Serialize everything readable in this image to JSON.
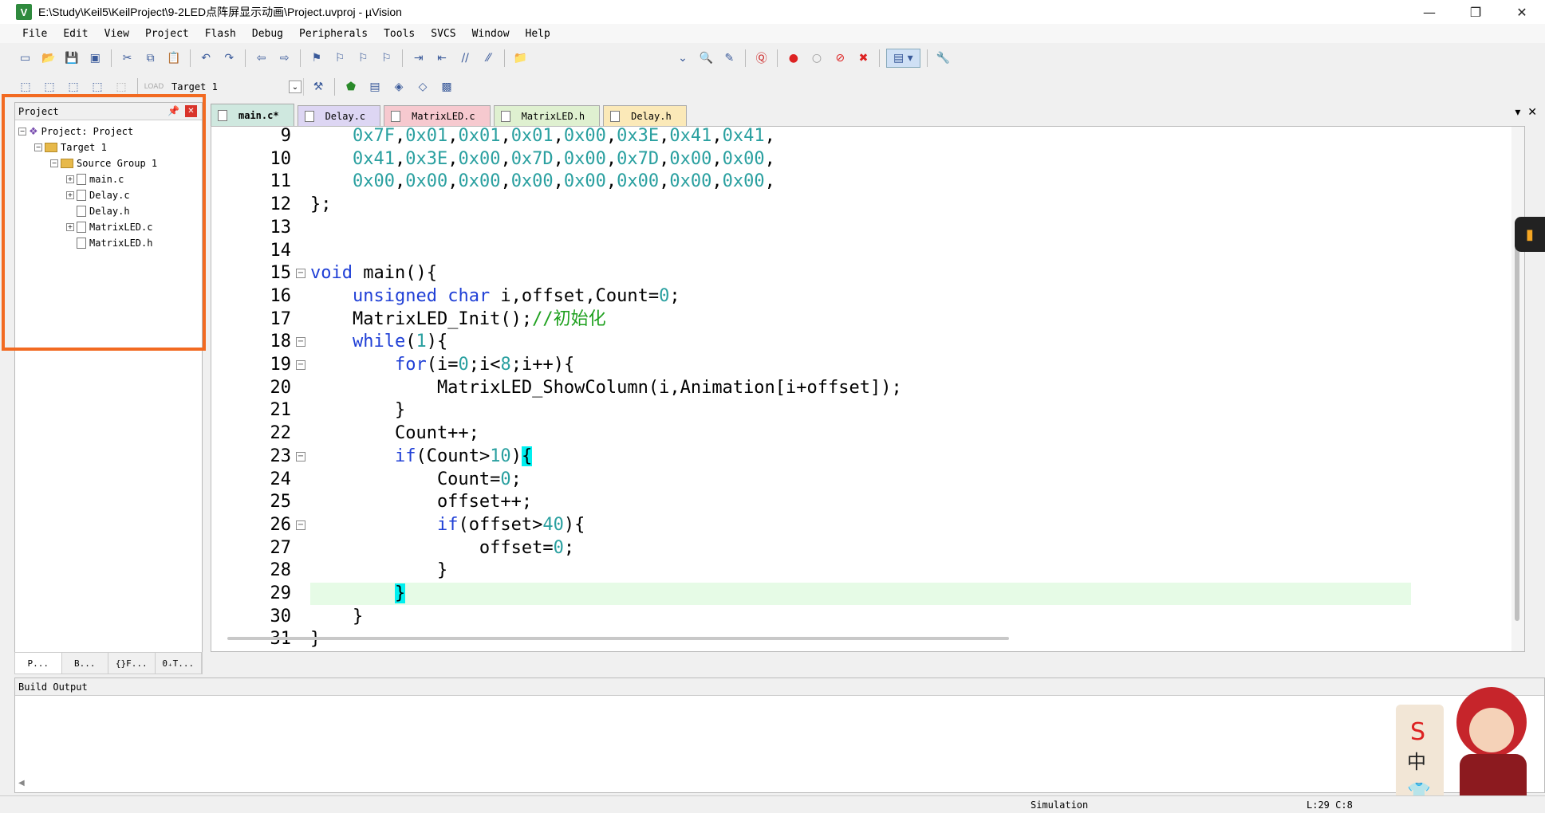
{
  "window": {
    "title": "E:\\Study\\Keil5\\KeilProject\\9-2LED点阵屏显示动画\\Project.uvproj - µVision",
    "app_icon": "V",
    "controls": [
      "—",
      "❐",
      "✕"
    ]
  },
  "menu": [
    "File",
    "Edit",
    "View",
    "Project",
    "Flash",
    "Debug",
    "Peripherals",
    "Tools",
    "SVCS",
    "Window",
    "Help"
  ],
  "toolbar2": {
    "target": "Target 1"
  },
  "project_panel": {
    "title": "Project",
    "tree": [
      {
        "label": "Project: Project",
        "depth": 0,
        "kind": "project",
        "expander": "⊟"
      },
      {
        "label": "Target 1",
        "depth": 1,
        "kind": "folder",
        "expander": "⊟"
      },
      {
        "label": "Source Group 1",
        "depth": 2,
        "kind": "folder",
        "expander": "⊟"
      },
      {
        "label": "main.c",
        "depth": 3,
        "kind": "file",
        "expander": "⊞"
      },
      {
        "label": "Delay.c",
        "depth": 3,
        "kind": "file",
        "expander": "⊞"
      },
      {
        "label": "Delay.h",
        "depth": 3,
        "kind": "file",
        "expander": ""
      },
      {
        "label": "MatrixLED.c",
        "depth": 3,
        "kind": "file",
        "expander": "⊞"
      },
      {
        "label": "MatrixLED.h",
        "depth": 3,
        "kind": "file",
        "expander": ""
      }
    ],
    "tabs": [
      "P...",
      "B...",
      "{}F...",
      "0₊T..."
    ]
  },
  "editor": {
    "tabs": [
      {
        "label": "main.c*",
        "color": "#cfe8df",
        "active": true
      },
      {
        "label": "Delay.c",
        "color": "#ddd6f3",
        "active": false
      },
      {
        "label": "MatrixLED.c",
        "color": "#f6c9cf",
        "active": false
      },
      {
        "label": "MatrixLED.h",
        "color": "#dff0d0",
        "active": false
      },
      {
        "label": "Delay.h",
        "color": "#fbe9b8",
        "active": false
      }
    ],
    "lines": [
      {
        "n": "9",
        "fold": "",
        "segs": [
          [
            "    ",
            ""
          ],
          [
            "0x7F",
            "num"
          ],
          [
            ",",
            ""
          ],
          [
            "0x01",
            "num"
          ],
          [
            ",",
            ""
          ],
          [
            "0x01",
            "num"
          ],
          [
            ",",
            ""
          ],
          [
            "0x01",
            "num"
          ],
          [
            ",",
            ""
          ],
          [
            "0x00",
            "num"
          ],
          [
            ",",
            ""
          ],
          [
            "0x3E",
            "num"
          ],
          [
            ",",
            ""
          ],
          [
            "0x41",
            "num"
          ],
          [
            ",",
            ""
          ],
          [
            "0x41",
            "num"
          ],
          [
            ",",
            ""
          ]
        ]
      },
      {
        "n": "10",
        "fold": "",
        "segs": [
          [
            "    ",
            ""
          ],
          [
            "0x41",
            "num"
          ],
          [
            ",",
            ""
          ],
          [
            "0x3E",
            "num"
          ],
          [
            ",",
            ""
          ],
          [
            "0x00",
            "num"
          ],
          [
            ",",
            ""
          ],
          [
            "0x7D",
            "num"
          ],
          [
            ",",
            ""
          ],
          [
            "0x00",
            "num"
          ],
          [
            ",",
            ""
          ],
          [
            "0x7D",
            "num"
          ],
          [
            ",",
            ""
          ],
          [
            "0x00",
            "num"
          ],
          [
            ",",
            ""
          ],
          [
            "0x00",
            "num"
          ],
          [
            ",",
            ""
          ]
        ]
      },
      {
        "n": "11",
        "fold": "",
        "segs": [
          [
            "    ",
            ""
          ],
          [
            "0x00",
            "num"
          ],
          [
            ",",
            ""
          ],
          [
            "0x00",
            "num"
          ],
          [
            ",",
            ""
          ],
          [
            "0x00",
            "num"
          ],
          [
            ",",
            ""
          ],
          [
            "0x00",
            "num"
          ],
          [
            ",",
            ""
          ],
          [
            "0x00",
            "num"
          ],
          [
            ",",
            ""
          ],
          [
            "0x00",
            "num"
          ],
          [
            ",",
            ""
          ],
          [
            "0x00",
            "num"
          ],
          [
            ",",
            ""
          ],
          [
            "0x00",
            "num"
          ],
          [
            ",",
            ""
          ]
        ]
      },
      {
        "n": "12",
        "fold": "",
        "segs": [
          [
            "};",
            ""
          ]
        ]
      },
      {
        "n": "13",
        "fold": "",
        "segs": []
      },
      {
        "n": "14",
        "fold": "",
        "segs": []
      },
      {
        "n": "15",
        "fold": "⊟",
        "segs": [
          [
            "void",
            "kw"
          ],
          [
            " main(){",
            ""
          ]
        ]
      },
      {
        "n": "16",
        "fold": "",
        "segs": [
          [
            "    ",
            ""
          ],
          [
            "unsigned",
            "kw"
          ],
          [
            " ",
            ""
          ],
          [
            "char",
            "kw"
          ],
          [
            " i,offset,Count=",
            ""
          ],
          [
            "0",
            "num"
          ],
          [
            ";",
            ""
          ]
        ]
      },
      {
        "n": "17",
        "fold": "",
        "segs": [
          [
            "    MatrixLED_Init();",
            ""
          ],
          [
            "//初始化",
            "cm"
          ]
        ]
      },
      {
        "n": "18",
        "fold": "⊟",
        "segs": [
          [
            "    ",
            ""
          ],
          [
            "while",
            "kw"
          ],
          [
            "(",
            ""
          ],
          [
            "1",
            "num"
          ],
          [
            "){",
            ""
          ]
        ]
      },
      {
        "n": "19",
        "fold": "⊟",
        "segs": [
          [
            "        ",
            ""
          ],
          [
            "for",
            "kw"
          ],
          [
            "(i=",
            ""
          ],
          [
            "0",
            "num"
          ],
          [
            ";i<",
            ""
          ],
          [
            "8",
            "num"
          ],
          [
            ";i++){",
            ""
          ]
        ]
      },
      {
        "n": "20",
        "fold": "",
        "segs": [
          [
            "            MatrixLED_ShowColumn(i,Animation[i+offset]);",
            ""
          ]
        ]
      },
      {
        "n": "21",
        "fold": "",
        "segs": [
          [
            "        }",
            ""
          ]
        ]
      },
      {
        "n": "22",
        "fold": "",
        "segs": [
          [
            "        Count++;",
            ""
          ]
        ]
      },
      {
        "n": "23",
        "fold": "⊟",
        "segs": [
          [
            "        ",
            ""
          ],
          [
            "if",
            "kw"
          ],
          [
            "(Count>",
            ""
          ],
          [
            "10",
            "num"
          ],
          [
            ")",
            ""
          ],
          [
            "{",
            "caret"
          ]
        ]
      },
      {
        "n": "24",
        "fold": "",
        "segs": [
          [
            "            Count=",
            ""
          ],
          [
            "0",
            "num"
          ],
          [
            ";",
            ""
          ]
        ]
      },
      {
        "n": "25",
        "fold": "",
        "segs": [
          [
            "            offset++;",
            ""
          ]
        ]
      },
      {
        "n": "26",
        "fold": "⊟",
        "segs": [
          [
            "            ",
            ""
          ],
          [
            "if",
            "kw"
          ],
          [
            "(offset>",
            ""
          ],
          [
            "40",
            "num"
          ],
          [
            "){",
            ""
          ]
        ]
      },
      {
        "n": "27",
        "fold": "",
        "segs": [
          [
            "                offset=",
            ""
          ],
          [
            "0",
            "num"
          ],
          [
            ";",
            ""
          ]
        ]
      },
      {
        "n": "28",
        "fold": "",
        "segs": [
          [
            "            }",
            ""
          ]
        ]
      },
      {
        "n": "29",
        "fold": "",
        "current": true,
        "segs": [
          [
            "        ",
            ""
          ],
          [
            "}",
            "caret"
          ]
        ]
      },
      {
        "n": "30",
        "fold": "",
        "segs": [
          [
            "    }",
            ""
          ]
        ]
      },
      {
        "n": "31",
        "fold": "",
        "segs": [
          [
            "}",
            ""
          ]
        ]
      }
    ]
  },
  "build_output": {
    "title": "Build Output"
  },
  "status": {
    "mode": "Simulation",
    "position": "L:29 C:8"
  },
  "colors": {
    "highlight": "#f26a21",
    "keyword": "#1f3fd6",
    "number": "#2aa0a0",
    "comment": "#1ea01e"
  }
}
